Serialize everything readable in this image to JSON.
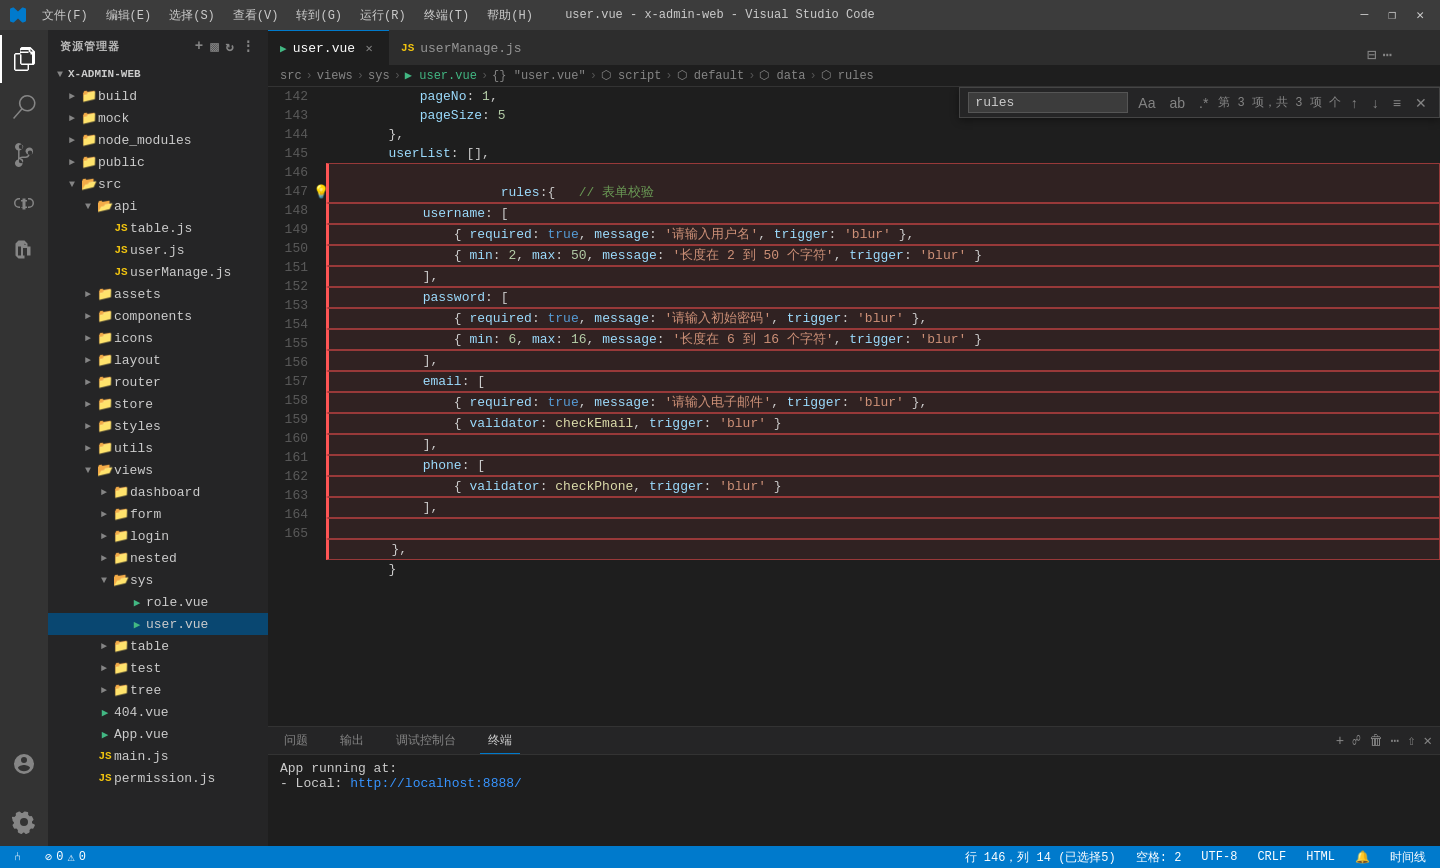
{
  "titleBar": {
    "title": "user.vue - x-admin-web - Visual Studio Code",
    "menus": [
      "文件(F)",
      "编辑(E)",
      "选择(S)",
      "查看(V)",
      "转到(G)",
      "运行(R)",
      "终端(T)",
      "帮助(H)"
    ]
  },
  "tabs": [
    {
      "id": "user-vue",
      "label": "user.vue",
      "icon": "vue",
      "active": true
    },
    {
      "id": "userManage-js",
      "label": "userManage.js",
      "icon": "js",
      "active": false
    }
  ],
  "breadcrumb": {
    "parts": [
      "src",
      ">",
      "views",
      ">",
      "sys",
      ">",
      "user.vue",
      ">",
      "{} \"user.vue\"",
      ">",
      "⬡ script",
      ">",
      "⬡ default",
      ">",
      "⬡ data",
      ">",
      "⬡ rules"
    ]
  },
  "findBar": {
    "query": "rules",
    "info": "第 3 项，共 3 项 个",
    "buttons": [
      "Aa",
      "ab",
      ".*",
      "↓",
      "≡",
      "✕"
    ]
  },
  "sidebar": {
    "title": "资源管理器",
    "root": "X-ADMIN-WEB",
    "items": [
      {
        "id": "build",
        "label": "build",
        "type": "folder",
        "depth": 1,
        "collapsed": true
      },
      {
        "id": "mock",
        "label": "mock",
        "type": "folder",
        "depth": 1,
        "collapsed": true
      },
      {
        "id": "node_modules",
        "label": "node_modules",
        "type": "folder",
        "depth": 1,
        "collapsed": true
      },
      {
        "id": "public",
        "label": "public",
        "type": "folder",
        "depth": 1,
        "collapsed": true
      },
      {
        "id": "src",
        "label": "src",
        "type": "folder",
        "depth": 1,
        "collapsed": false
      },
      {
        "id": "api",
        "label": "api",
        "type": "folder",
        "depth": 2,
        "collapsed": false
      },
      {
        "id": "table-js",
        "label": "table.js",
        "type": "js",
        "depth": 3
      },
      {
        "id": "user-js",
        "label": "user.js",
        "type": "js",
        "depth": 3
      },
      {
        "id": "userManage-js",
        "label": "userManage.js",
        "type": "js",
        "depth": 3
      },
      {
        "id": "assets",
        "label": "assets",
        "type": "folder",
        "depth": 2,
        "collapsed": true
      },
      {
        "id": "components",
        "label": "components",
        "type": "folder",
        "depth": 2,
        "collapsed": true
      },
      {
        "id": "icons",
        "label": "icons",
        "type": "folder",
        "depth": 2,
        "collapsed": true
      },
      {
        "id": "layout",
        "label": "layout",
        "type": "folder",
        "depth": 2,
        "collapsed": true
      },
      {
        "id": "router",
        "label": "router",
        "type": "folder",
        "depth": 2,
        "collapsed": true
      },
      {
        "id": "store",
        "label": "store",
        "type": "folder",
        "depth": 2,
        "collapsed": true
      },
      {
        "id": "styles",
        "label": "styles",
        "type": "folder",
        "depth": 2,
        "collapsed": true
      },
      {
        "id": "utils",
        "label": "utils",
        "type": "folder",
        "depth": 2,
        "collapsed": true
      },
      {
        "id": "views",
        "label": "views",
        "type": "folder",
        "depth": 2,
        "collapsed": false
      },
      {
        "id": "dashboard",
        "label": "dashboard",
        "type": "folder",
        "depth": 3,
        "collapsed": true
      },
      {
        "id": "form",
        "label": "form",
        "type": "folder",
        "depth": 3,
        "collapsed": true
      },
      {
        "id": "login",
        "label": "login",
        "type": "folder",
        "depth": 3,
        "collapsed": true
      },
      {
        "id": "nested",
        "label": "nested",
        "type": "folder",
        "depth": 3,
        "collapsed": true
      },
      {
        "id": "sys",
        "label": "sys",
        "type": "folder",
        "depth": 3,
        "collapsed": false
      },
      {
        "id": "role-vue",
        "label": "role.vue",
        "type": "vue",
        "depth": 4
      },
      {
        "id": "user-vue",
        "label": "user.vue",
        "type": "vue",
        "depth": 4,
        "active": true
      },
      {
        "id": "table",
        "label": "table",
        "type": "folder",
        "depth": 3,
        "collapsed": true
      },
      {
        "id": "test",
        "label": "test",
        "type": "folder",
        "depth": 3,
        "collapsed": true
      },
      {
        "id": "tree",
        "label": "tree",
        "type": "folder",
        "depth": 3,
        "collapsed": true
      },
      {
        "id": "404-vue",
        "label": "404.vue",
        "type": "vue",
        "depth": 2
      },
      {
        "id": "App-vue",
        "label": "App.vue",
        "type": "vue",
        "depth": 2
      },
      {
        "id": "main-js",
        "label": "main.js",
        "type": "js",
        "depth": 2
      },
      {
        "id": "permission-js",
        "label": "permission.js",
        "type": "js",
        "depth": 2
      }
    ]
  },
  "code": {
    "lines": [
      {
        "num": 142,
        "text": "            pageNo: 1,",
        "highlighted": false
      },
      {
        "num": 143,
        "text": "            pageSize: 5",
        "highlighted": false
      },
      {
        "num": 144,
        "text": "        },",
        "highlighted": false
      },
      {
        "num": 145,
        "text": "        userList: [],",
        "highlighted": false
      },
      {
        "num": 146,
        "text": "        rules:{   // 表单校验",
        "highlighted": true,
        "hasBulb": true
      },
      {
        "num": 147,
        "text": "            username: [",
        "highlighted": true
      },
      {
        "num": 148,
        "text": "                { required: true, message: '请输入用户名', trigger: 'blur' },",
        "highlighted": true
      },
      {
        "num": 149,
        "text": "                { min: 2, max: 50, message: '长度在 2 到 50 个字符', trigger: 'blur' }",
        "highlighted": true
      },
      {
        "num": 150,
        "text": "            ],",
        "highlighted": true
      },
      {
        "num": 151,
        "text": "            password: [",
        "highlighted": true
      },
      {
        "num": 152,
        "text": "                { required: true, message: '请输入初始密码', trigger: 'blur' },",
        "highlighted": true
      },
      {
        "num": 153,
        "text": "                { min: 6, max: 16, message: '长度在 6 到 16 个字符', trigger: 'blur' }",
        "highlighted": true
      },
      {
        "num": 154,
        "text": "            ],",
        "highlighted": true
      },
      {
        "num": 155,
        "text": "            email: [",
        "highlighted": true
      },
      {
        "num": 156,
        "text": "                { required: true, message: '请输入电子邮件', trigger: 'blur' },",
        "highlighted": true
      },
      {
        "num": 157,
        "text": "                { validator: checkEmail, trigger: 'blur' }",
        "highlighted": true
      },
      {
        "num": 158,
        "text": "            ],",
        "highlighted": true
      },
      {
        "num": 159,
        "text": "            phone: [",
        "highlighted": true
      },
      {
        "num": 160,
        "text": "                { validator: checkPhone, trigger: 'blur' }",
        "highlighted": true
      },
      {
        "num": 161,
        "text": "            ],",
        "highlighted": true
      },
      {
        "num": 162,
        "text": "",
        "highlighted": true
      },
      {
        "num": 163,
        "text": "        },",
        "highlighted": true
      },
      {
        "num": 164,
        "text": "        }",
        "highlighted": false
      },
      {
        "num": 165,
        "text": "",
        "highlighted": false
      }
    ]
  },
  "terminal": {
    "tabs": [
      "问题",
      "输出",
      "调试控制台",
      "终端"
    ],
    "activeTab": "终端",
    "content": [
      "App running at:",
      "  - Local:   http://localhost:8888/"
    ]
  },
  "statusBar": {
    "left": [
      "⓪ 0",
      "⚠ 0"
    ],
    "lineInfo": "行 146，列 14 (已选择5)",
    "encoding": "空格: 2",
    "fileEncoding": "UTF-8",
    "lineEnding": "CRLF",
    "language": "HTML",
    "bell": "🔔",
    "gitBranch": "时间线"
  }
}
